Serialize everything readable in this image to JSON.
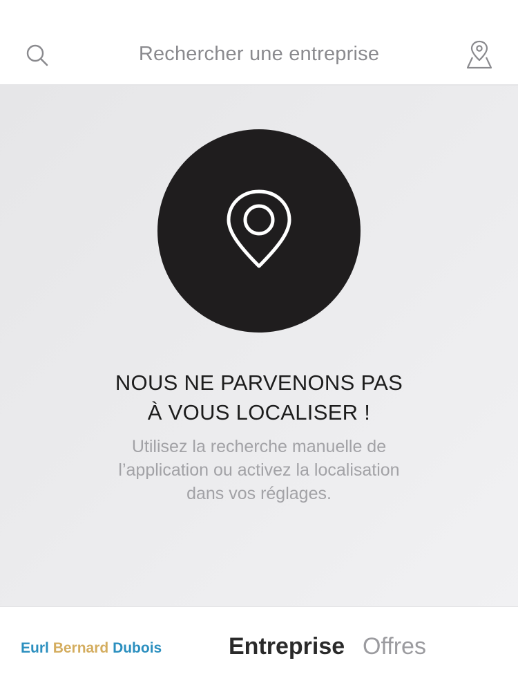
{
  "header": {
    "search_placeholder": "Rechercher une entreprise",
    "search_icon": "search-icon",
    "map_icon": "map-pin-icon"
  },
  "location_error": {
    "icon": "location-pin-icon",
    "title_line1": "NOUS NE PARVENONS PAS",
    "title_line2": "À VOUS LOCALISER !",
    "desc_line1": "Utilisez la recherche manuelle de",
    "desc_line2": "l’application ou activez la localisation",
    "desc_line3": "dans vos réglages."
  },
  "footer": {
    "brand": {
      "word1": "Eurl",
      "word2": "Bernard",
      "word3": "Dubois"
    },
    "tabs": [
      {
        "label": "Entreprise",
        "active": true
      },
      {
        "label": "Offres",
        "active": false
      }
    ]
  },
  "colors": {
    "brand_blue": "#2b8fbf",
    "brand_gold": "#d4ad5f",
    "circle": "#1f1d1e"
  }
}
